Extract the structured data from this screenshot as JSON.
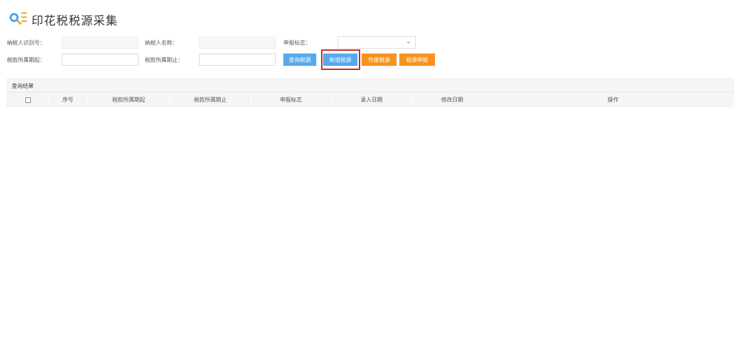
{
  "header": {
    "title": "印花税税源采集"
  },
  "form": {
    "taxpayer_id_label": "纳税人识别号：",
    "taxpayer_id_value": "",
    "taxpayer_name_label": "纳税人名称：",
    "taxpayer_name_value": "",
    "declare_flag_label": "申报标志：",
    "declare_flag_value": "",
    "period_start_label": "税款所属期起：",
    "period_start_value": "",
    "period_end_label": "税款所属期止：",
    "period_end_value": ""
  },
  "buttons": {
    "query": "查询税源",
    "add": "新增税源",
    "void": "作废税源",
    "declare": "税源申报"
  },
  "results": {
    "title": "查询结果",
    "columns": [
      "序号",
      "税款所属期起",
      "税款所属期止",
      "申报标志",
      "录入日期",
      "修改日期",
      "操作"
    ]
  },
  "colors": {
    "primary": "#58a9ec",
    "accent": "#f7931e",
    "highlight": "#c9252c"
  }
}
